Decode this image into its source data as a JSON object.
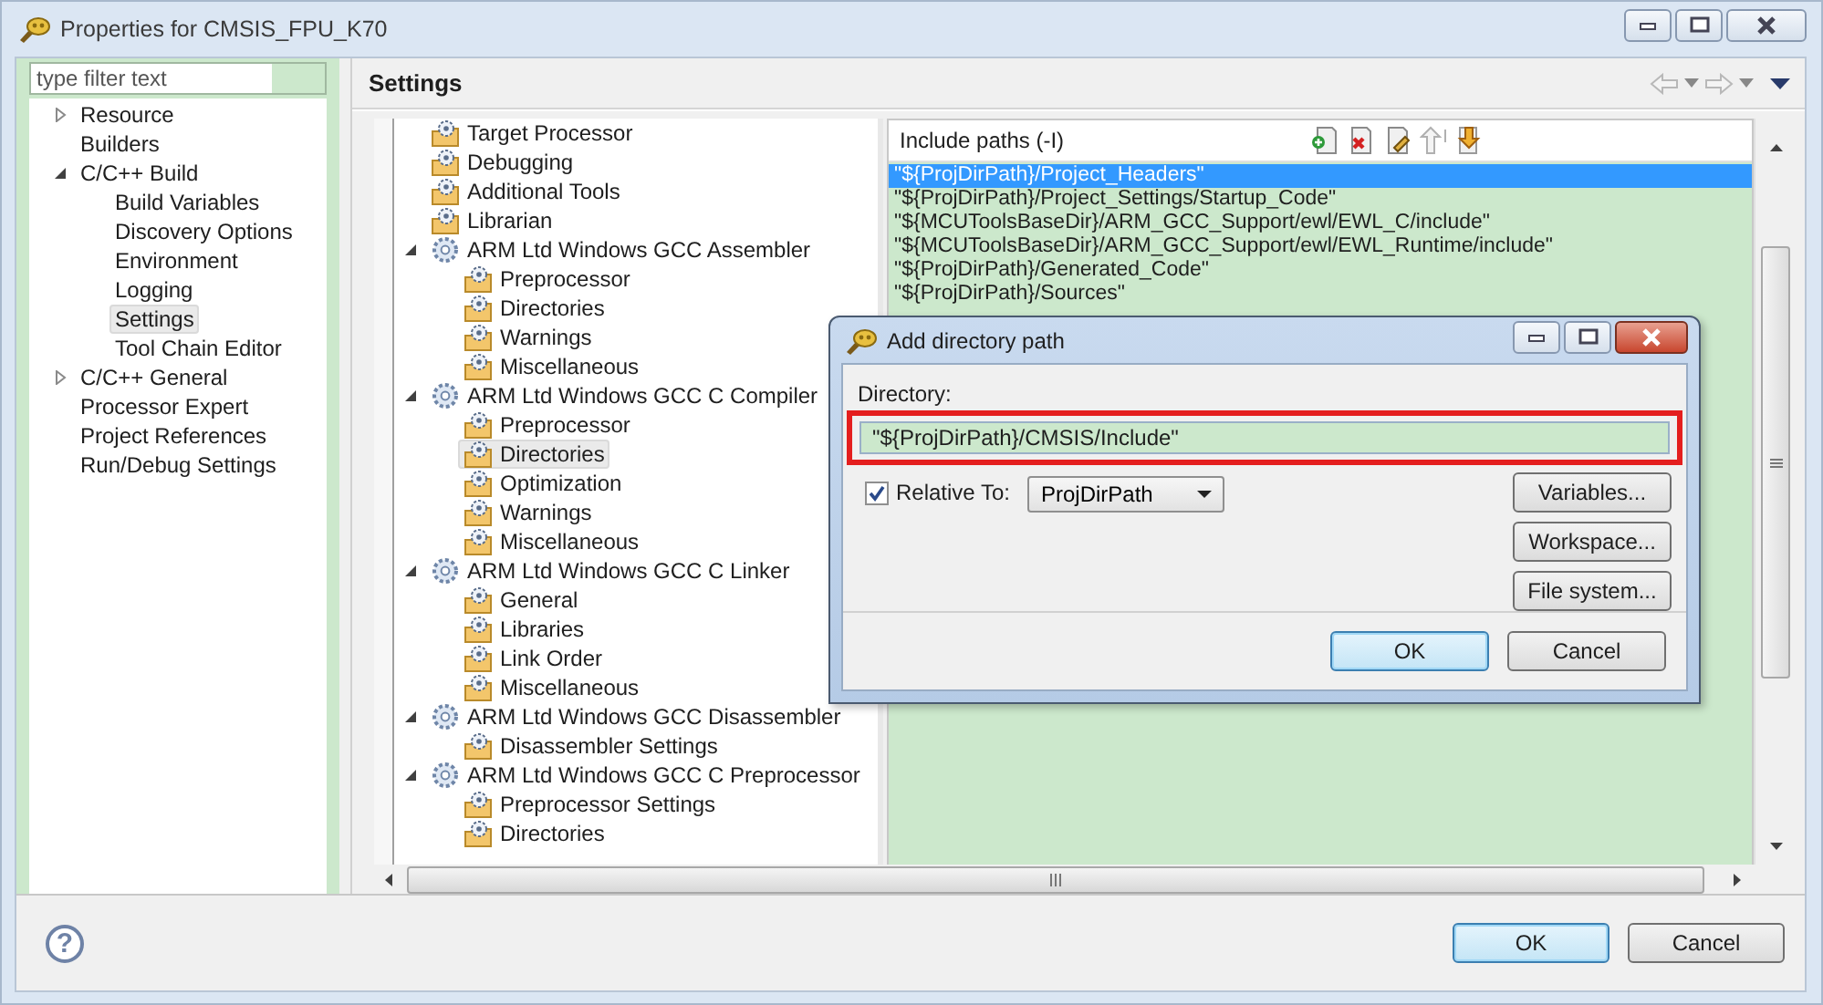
{
  "window": {
    "title": "Properties for CMSIS_FPU_K70"
  },
  "filter": {
    "placeholder": "type filter text"
  },
  "nav": [
    {
      "label": "Resource",
      "expanded": false,
      "selected": false
    },
    {
      "label": "Builders",
      "selected": false
    },
    {
      "label": "C/C++ Build",
      "expanded": true,
      "selected": false,
      "children": [
        {
          "label": "Build Variables",
          "selected": false
        },
        {
          "label": "Discovery Options",
          "selected": false
        },
        {
          "label": "Environment",
          "selected": false
        },
        {
          "label": "Logging",
          "selected": false
        },
        {
          "label": "Settings",
          "selected": true
        },
        {
          "label": "Tool Chain Editor",
          "selected": false
        }
      ]
    },
    {
      "label": "C/C++ General",
      "expanded": false,
      "selected": false
    },
    {
      "label": "Processor Expert",
      "selected": false
    },
    {
      "label": "Project References",
      "selected": false
    },
    {
      "label": "Run/Debug Settings",
      "selected": false
    }
  ],
  "page_title": "Settings",
  "tool_tree": [
    {
      "label": "Target Processor",
      "kind": "option",
      "selected": false
    },
    {
      "label": "Debugging",
      "kind": "option",
      "selected": false
    },
    {
      "label": "Additional Tools",
      "kind": "option",
      "selected": false
    },
    {
      "label": "Librarian",
      "kind": "option",
      "selected": false
    },
    {
      "label": "ARM Ltd Windows GCC Assembler",
      "kind": "tool",
      "expanded": true,
      "selected": false,
      "children": [
        {
          "label": "Preprocessor",
          "kind": "option",
          "selected": false
        },
        {
          "label": "Directories",
          "kind": "option",
          "selected": false
        },
        {
          "label": "Warnings",
          "kind": "option",
          "selected": false
        },
        {
          "label": "Miscellaneous",
          "kind": "option",
          "selected": false
        }
      ]
    },
    {
      "label": "ARM Ltd Windows GCC C Compiler",
      "kind": "tool",
      "expanded": true,
      "selected": false,
      "children": [
        {
          "label": "Preprocessor",
          "kind": "option",
          "selected": false
        },
        {
          "label": "Directories",
          "kind": "option",
          "selected": true
        },
        {
          "label": "Optimization",
          "kind": "option",
          "selected": false
        },
        {
          "label": "Warnings",
          "kind": "option",
          "selected": false
        },
        {
          "label": "Miscellaneous",
          "kind": "option",
          "selected": false
        }
      ]
    },
    {
      "label": "ARM Ltd Windows GCC C Linker",
      "kind": "tool",
      "expanded": true,
      "selected": false,
      "children": [
        {
          "label": "General",
          "kind": "option",
          "selected": false
        },
        {
          "label": "Libraries",
          "kind": "option",
          "selected": false
        },
        {
          "label": "Link Order",
          "kind": "option",
          "selected": false
        },
        {
          "label": "Miscellaneous",
          "kind": "option",
          "selected": false
        }
      ]
    },
    {
      "label": "ARM Ltd Windows GCC Disassembler",
      "kind": "tool",
      "expanded": true,
      "selected": false,
      "children": [
        {
          "label": "Disassembler Settings",
          "kind": "option",
          "selected": false
        }
      ]
    },
    {
      "label": "ARM Ltd Windows GCC C Preprocessor",
      "kind": "tool",
      "expanded": true,
      "selected": false,
      "children": [
        {
          "label": "Preprocessor Settings",
          "kind": "option",
          "selected": false
        },
        {
          "label": "Directories",
          "kind": "option",
          "selected": false
        }
      ]
    }
  ],
  "include_paths": {
    "title": "Include paths (-I)",
    "paths": [
      {
        "text": "\"${ProjDirPath}/Project_Headers\"",
        "selected": true
      },
      {
        "text": "\"${ProjDirPath}/Project_Settings/Startup_Code\"",
        "selected": false
      },
      {
        "text": "\"${MCUToolsBaseDir}/ARM_GCC_Support/ewl/EWL_C/include\"",
        "selected": false
      },
      {
        "text": "\"${MCUToolsBaseDir}/ARM_GCC_Support/ewl/EWL_Runtime/include\"",
        "selected": false
      },
      {
        "text": "\"${ProjDirPath}/Generated_Code\"",
        "selected": false
      },
      {
        "text": "\"${ProjDirPath}/Sources\"",
        "selected": false
      }
    ]
  },
  "dialog": {
    "title": "Add directory path",
    "directory": {
      "label": "Directory:",
      "value": "\"${ProjDirPath}/CMSIS/Include\"",
      "highlighted": true
    },
    "relative": {
      "label": "Relative To:",
      "checked": true,
      "value": "ProjDirPath"
    },
    "side_buttons": [
      "Variables...",
      "Workspace...",
      "File system..."
    ],
    "buttons": [
      {
        "label": "OK",
        "default": true
      },
      {
        "label": "Cancel",
        "default": false
      }
    ]
  },
  "help": "?",
  "buttons": [
    {
      "label": "OK",
      "default": true
    },
    {
      "label": "Cancel",
      "default": false
    }
  ]
}
